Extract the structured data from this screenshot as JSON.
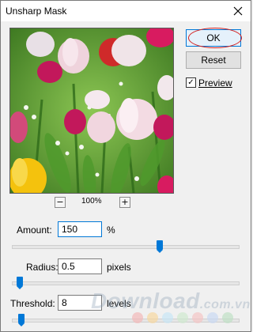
{
  "window": {
    "title": "Unsharp Mask"
  },
  "buttons": {
    "ok": "OK",
    "reset": "Reset"
  },
  "preview": {
    "label": "Preview",
    "checked": true
  },
  "zoom": {
    "minus": "−",
    "plus": "+",
    "value": "100%"
  },
  "fields": {
    "amount": {
      "label": "Amount:",
      "value": "150",
      "unit": "%",
      "level": 0.66
    },
    "radius": {
      "label": "Radius:",
      "value": "0.5",
      "unit": "pixels",
      "level": 0.02
    },
    "threshold": {
      "label": "Threshold:",
      "value": "8",
      "unit": "levels",
      "level": 0.03
    }
  },
  "watermark": {
    "text": "Download",
    "suffix": ".com.vn"
  },
  "colors": {
    "accent": "#0078d7",
    "annotation": "#d42020",
    "dots": [
      "#f2b8b8",
      "#f7d7a0",
      "#c8e6f5",
      "#cfe8cf",
      "#f4c5c5",
      "#c9d8f2",
      "#bfe0c5"
    ]
  }
}
